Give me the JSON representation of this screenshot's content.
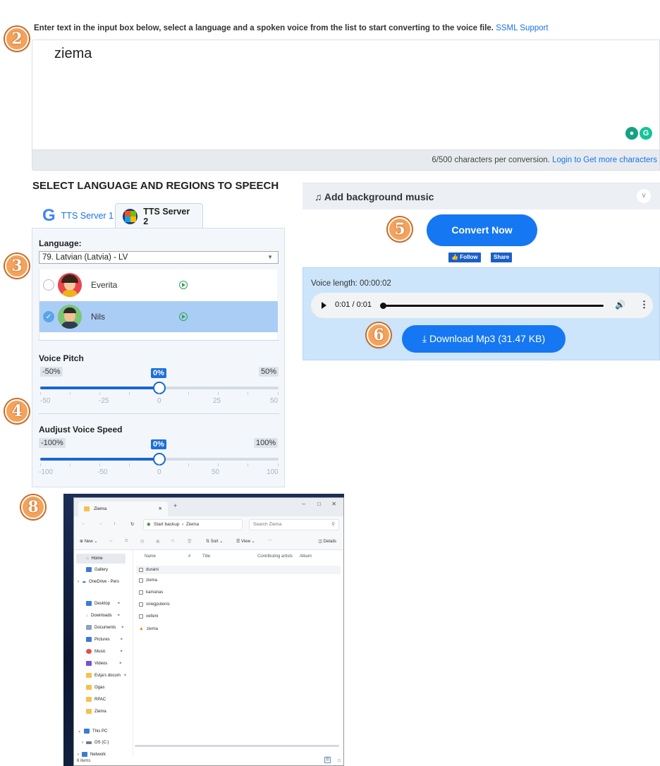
{
  "instructions": {
    "text": "Enter text in the input box below, select a language and a spoken voice from the list to start converting to the voice file.",
    "ssml_link": "SSML Support"
  },
  "textarea": {
    "value": "ziema",
    "counter": "6/500 characters per conversion.",
    "login_link": "Login to Get more characters"
  },
  "section_title": "SELECT LANGUAGE AND REGIONS TO SPEECH",
  "tabs": [
    {
      "label": "TTS Server 1",
      "active": false
    },
    {
      "label": "TTS Server 2",
      "active": true
    }
  ],
  "language": {
    "label": "Language:",
    "selected": "79. Latvian (Latvia) - LV"
  },
  "voices": [
    {
      "name": "Everita",
      "selected": false
    },
    {
      "name": "Nils",
      "selected": true
    }
  ],
  "pitch": {
    "label": "Voice Pitch",
    "min_label": "-50%",
    "value_label": "0%",
    "max_label": "50%",
    "value": 0,
    "min": -50,
    "max": 50,
    "tick_labels": [
      "-50",
      "-25",
      "0",
      "25",
      "50"
    ]
  },
  "speed": {
    "label": "Audjust Voice Speed",
    "min_label": "-100%",
    "value_label": "0%",
    "max_label": "100%",
    "value": 0,
    "min": -100,
    "max": 100,
    "tick_labels": [
      "-100",
      "-50",
      "0",
      "50",
      "100"
    ]
  },
  "background_music": {
    "label": "Add background music"
  },
  "convert_button": "Convert Now",
  "social": {
    "follow": "Follow",
    "share": "Share"
  },
  "result": {
    "voice_length": "Voice length: 00:00:02",
    "player_time": "0:01 / 0:01",
    "download_button": "Download Mp3 (31.47 KB)"
  },
  "badges": [
    "2",
    "3",
    "4",
    "5",
    "6",
    "8"
  ],
  "colors": {
    "accent": "#1577f2",
    "badge": "#f5a25a",
    "selected_row": "#aacdf5",
    "result_bg": "#cde5fb"
  },
  "explorer": {
    "tab_title": "Ziema",
    "breadcrumb": [
      "Start backup",
      "Ziema"
    ],
    "search_placeholder": "Search Ziema",
    "toolbar": {
      "new": "New",
      "sort": "Sort",
      "view": "View",
      "more": "···",
      "details": "Details"
    },
    "sidebar": [
      {
        "label": "Home",
        "icon": "home-icon"
      },
      {
        "label": "Gallery",
        "icon": "gallery-icon"
      },
      {
        "label": "OneDrive - Pers",
        "icon": "cloud-icon"
      },
      {
        "label": "Desktop",
        "icon": "desktop-icon"
      },
      {
        "label": "Downloads",
        "icon": "download-icon"
      },
      {
        "label": "Documents",
        "icon": "document-icon"
      },
      {
        "label": "Pictures",
        "icon": "pictures-icon"
      },
      {
        "label": "Music",
        "icon": "music-icon"
      },
      {
        "label": "Videos",
        "icon": "video-icon"
      },
      {
        "label": "Evija's docum",
        "icon": "folder-icon"
      },
      {
        "label": "Ogas",
        "icon": "folder-icon"
      },
      {
        "label": "RPAC",
        "icon": "folder-icon"
      },
      {
        "label": "Ziema",
        "icon": "folder-icon"
      },
      {
        "label": "This PC",
        "icon": "pc-icon"
      },
      {
        "label": "OS (C:)",
        "icon": "drive-icon"
      },
      {
        "label": "Network",
        "icon": "network-icon"
      }
    ],
    "columns": [
      "Name",
      "#",
      "Title",
      "Contributing artists",
      "Album"
    ],
    "files": [
      {
        "name": "duraini",
        "icon": "audio-file-icon"
      },
      {
        "name": "ziema",
        "icon": "audio-file-icon"
      },
      {
        "name": "kamanas",
        "icon": "audio-file-icon"
      },
      {
        "name": "sniegputenis",
        "icon": "audio-file-icon"
      },
      {
        "name": "velteni",
        "icon": "audio-file-icon"
      },
      {
        "name": "ziema",
        "icon": "vlc-icon"
      }
    ],
    "status": "6 items"
  }
}
